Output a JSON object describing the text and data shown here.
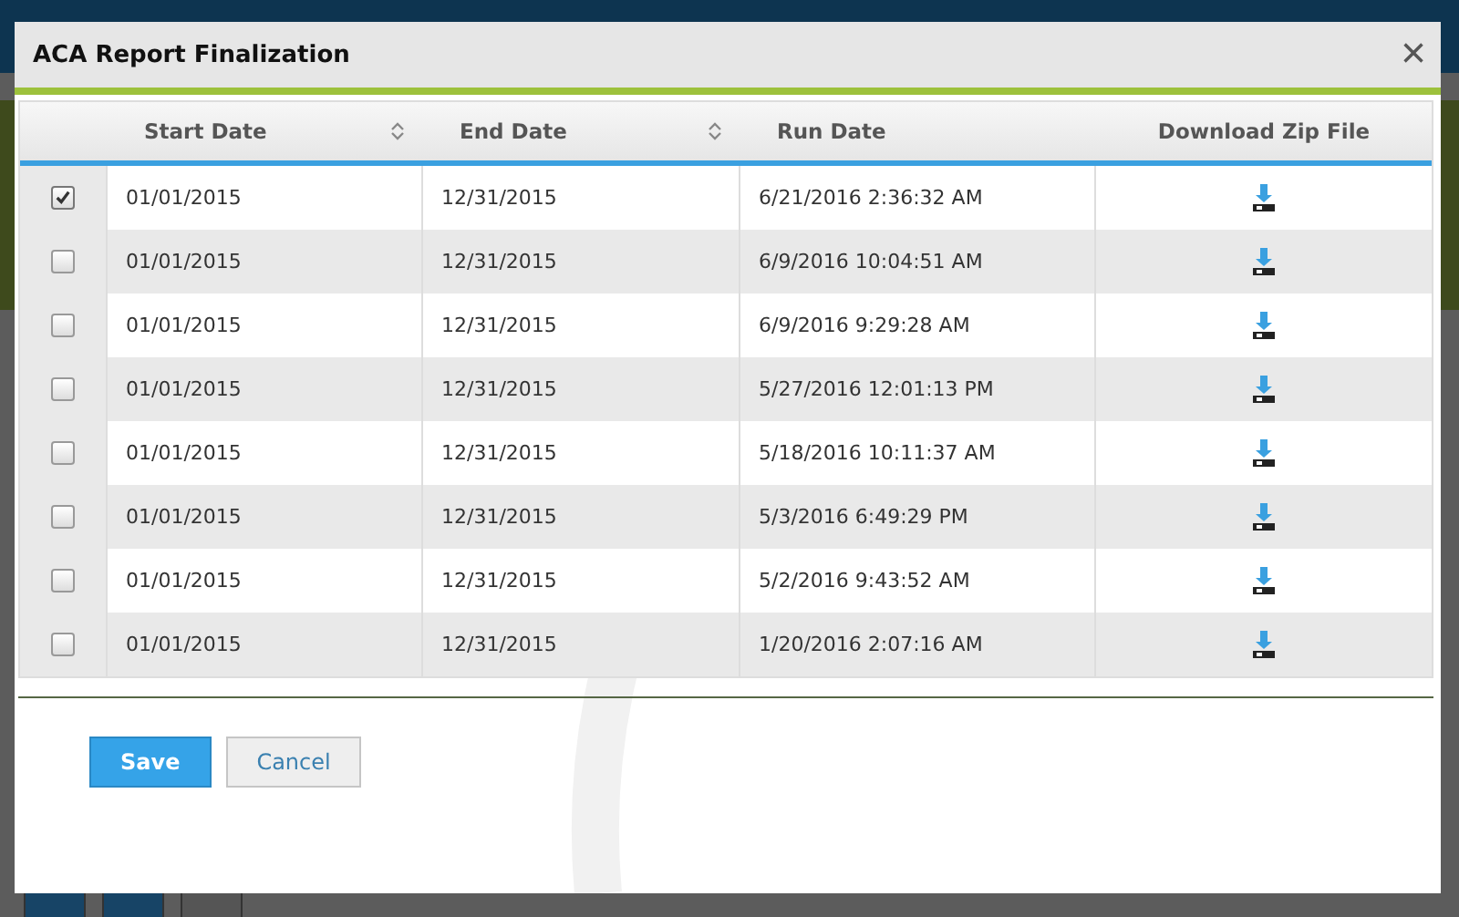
{
  "background_buttons": [
    {
      "kind": "primary"
    },
    {
      "kind": "primary"
    },
    {
      "kind": "secondary"
    }
  ],
  "dialog": {
    "title": "ACA Report Finalization",
    "close": "×"
  },
  "table": {
    "columns": [
      {
        "label": "Start Date",
        "sortable": true
      },
      {
        "label": "End Date",
        "sortable": true
      },
      {
        "label": "Run Date",
        "sortable": false
      },
      {
        "label": "Download Zip File",
        "sortable": false
      }
    ],
    "rows": [
      {
        "checked": true,
        "start": "01/01/2015",
        "end": "12/31/2015",
        "run": "6/21/2016 2:36:32 AM"
      },
      {
        "checked": false,
        "start": "01/01/2015",
        "end": "12/31/2015",
        "run": "6/9/2016 10:04:51 AM"
      },
      {
        "checked": false,
        "start": "01/01/2015",
        "end": "12/31/2015",
        "run": "6/9/2016 9:29:28 AM"
      },
      {
        "checked": false,
        "start": "01/01/2015",
        "end": "12/31/2015",
        "run": "5/27/2016 12:01:13 PM"
      },
      {
        "checked": false,
        "start": "01/01/2015",
        "end": "12/31/2015",
        "run": "5/18/2016 10:11:37 AM"
      },
      {
        "checked": false,
        "start": "01/01/2015",
        "end": "12/31/2015",
        "run": "5/3/2016 6:49:29 PM"
      },
      {
        "checked": false,
        "start": "01/01/2015",
        "end": "12/31/2015",
        "run": "5/2/2016 9:43:52 AM"
      },
      {
        "checked": false,
        "start": "01/01/2015",
        "end": "12/31/2015",
        "run": "1/20/2016 2:07:16 AM"
      }
    ]
  },
  "buttons": [
    {
      "label": "Save",
      "kind": "primary"
    },
    {
      "label": "Cancel",
      "kind": "secondary"
    }
  ]
}
